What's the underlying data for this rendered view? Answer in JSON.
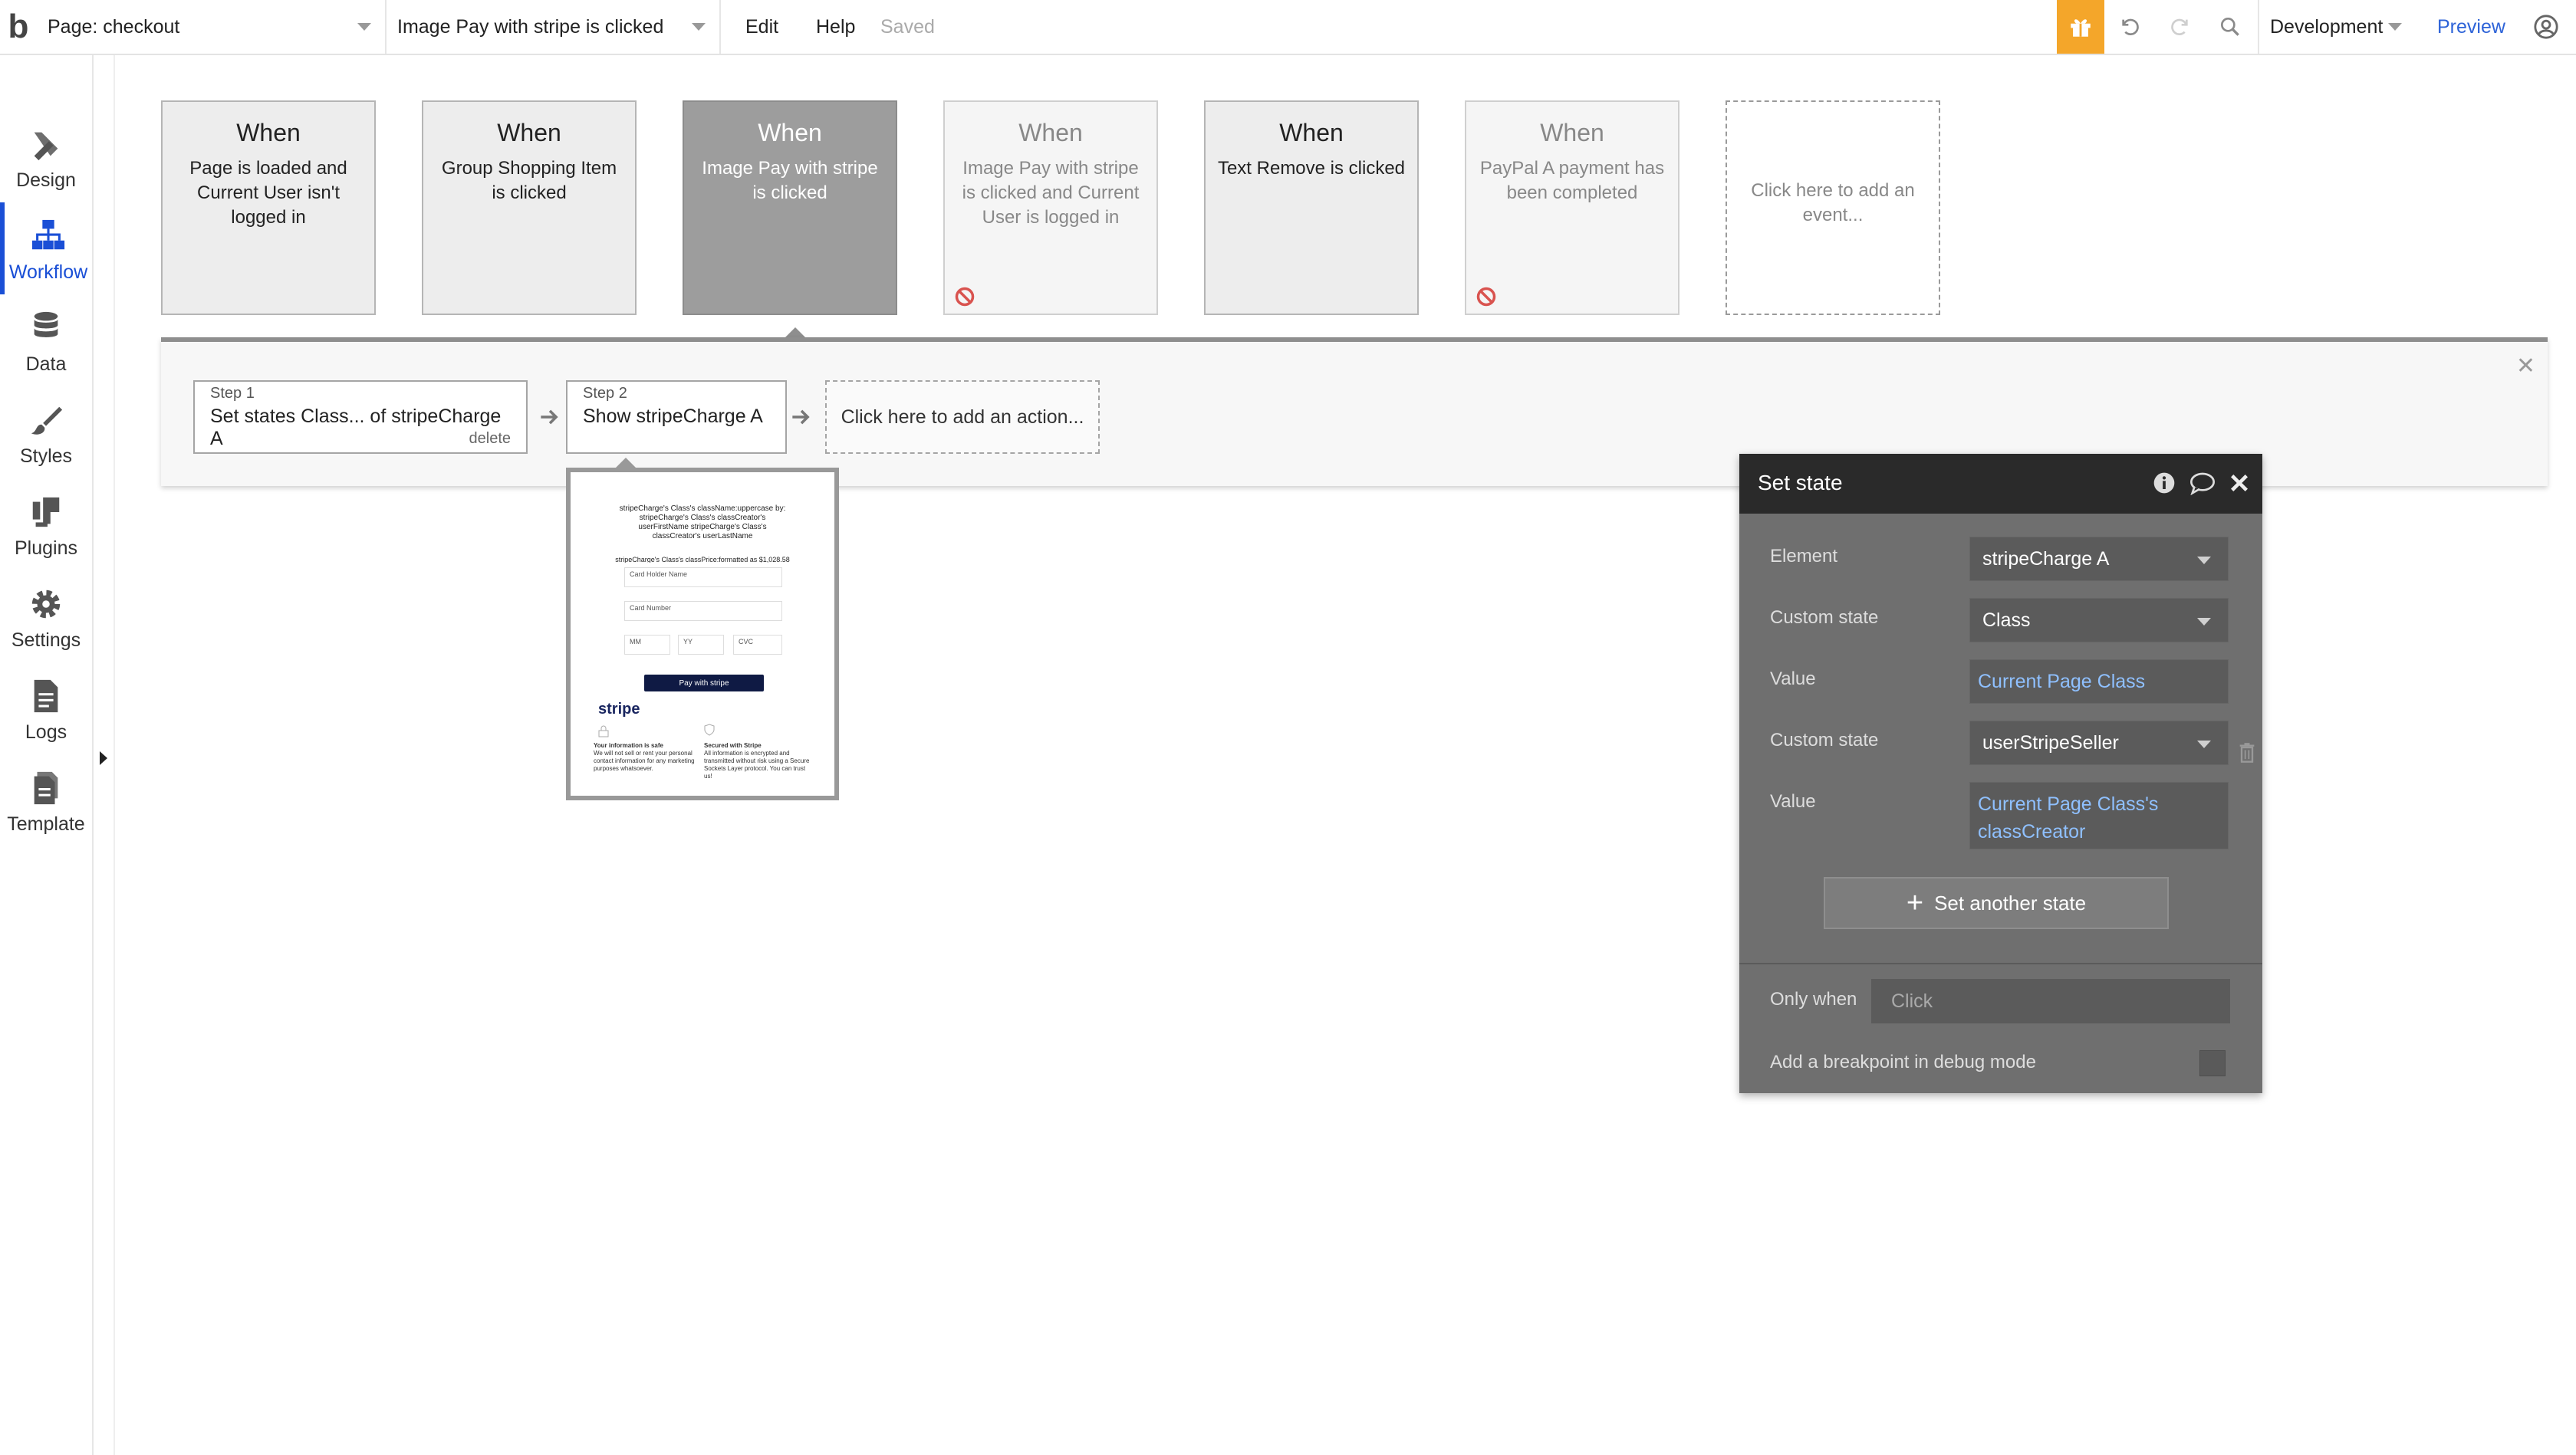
{
  "topbar": {
    "logo": "b",
    "page_selector": "Page: checkout",
    "event_selector": "Image Pay with stripe is clicked",
    "menu_edit": "Edit",
    "menu_help": "Help",
    "status": "Saved",
    "environment": "Development",
    "preview": "Preview"
  },
  "leftnav": {
    "items": [
      {
        "label": "Design",
        "icon": "design-icon"
      },
      {
        "label": "Workflow",
        "icon": "workflow-icon"
      },
      {
        "label": "Data",
        "icon": "data-icon"
      },
      {
        "label": "Styles",
        "icon": "styles-icon"
      },
      {
        "label": "Plugins",
        "icon": "plugins-icon"
      },
      {
        "label": "Settings",
        "icon": "settings-icon"
      },
      {
        "label": "Logs",
        "icon": "logs-icon"
      },
      {
        "label": "Template",
        "icon": "template-icon"
      }
    ],
    "active": "Workflow"
  },
  "events": [
    {
      "when": "When",
      "desc": "Page is loaded and Current User isn't logged in",
      "state": "normal"
    },
    {
      "when": "When",
      "desc": "Group Shopping Item is clicked",
      "state": "normal"
    },
    {
      "when": "When",
      "desc": "Image Pay with stripe is clicked",
      "state": "selected"
    },
    {
      "when": "When",
      "desc": "Image Pay with stripe is clicked and Current User is logged in",
      "state": "disabled"
    },
    {
      "when": "When",
      "desc": "Text Remove is clicked",
      "state": "normal"
    },
    {
      "when": "When",
      "desc": "PayPal A payment has been completed",
      "state": "disabled"
    },
    {
      "when": "",
      "desc": "Click here to add an event...",
      "state": "add"
    }
  ],
  "workflow": {
    "steps": [
      {
        "label": "Step 1",
        "title": "Set states Class... of stripeCharge A",
        "delete": "delete"
      },
      {
        "label": "Step 2",
        "title": "Show stripeCharge A"
      }
    ],
    "add_action": "Click here to add an action..."
  },
  "preview": {
    "header_text": "stripeCharge's Class's className:uppercase by: stripeCharge's Class's classCreator's userFirstName stripeCharge's Class's classCreator's userLastName",
    "price_text": "stripeCharge's Class's classPrice:formatted as $1,028.58",
    "card_holder": "Card Holder Name",
    "card_number": "Card Number",
    "mm": "MM",
    "yy": "YY",
    "cvc": "CVC",
    "button": "Pay with stripe",
    "brand": "stripe",
    "info_title": "Your information is safe",
    "info_body": "We will not sell or rent your personal contact information for any marketing purposes whatsoever.",
    "secured_title": "Secured with Stripe",
    "secured_body": "All information is encrypted and transmitted without risk using a Secure Sockets Layer protocol. You can trust us!"
  },
  "set_state": {
    "title": "Set state",
    "element_label": "Element",
    "element_value": "stripeCharge A",
    "custom_state_label": "Custom state",
    "custom_state_1": "Class",
    "value_label": "Value",
    "value_1": "Current Page Class",
    "custom_state_2": "userStripeSeller",
    "value_2": "Current Page Class's classCreator",
    "set_another": "Set another state",
    "only_when_label": "Only when",
    "only_when_placeholder": "Click",
    "breakpoint_label": "Add a breakpoint in debug mode"
  },
  "colors": {
    "accent_blue": "#1a4fd6",
    "gift": "#f4a62a",
    "dynamic_value": "#8fc0ff",
    "disabled_red": "#d9534f"
  }
}
